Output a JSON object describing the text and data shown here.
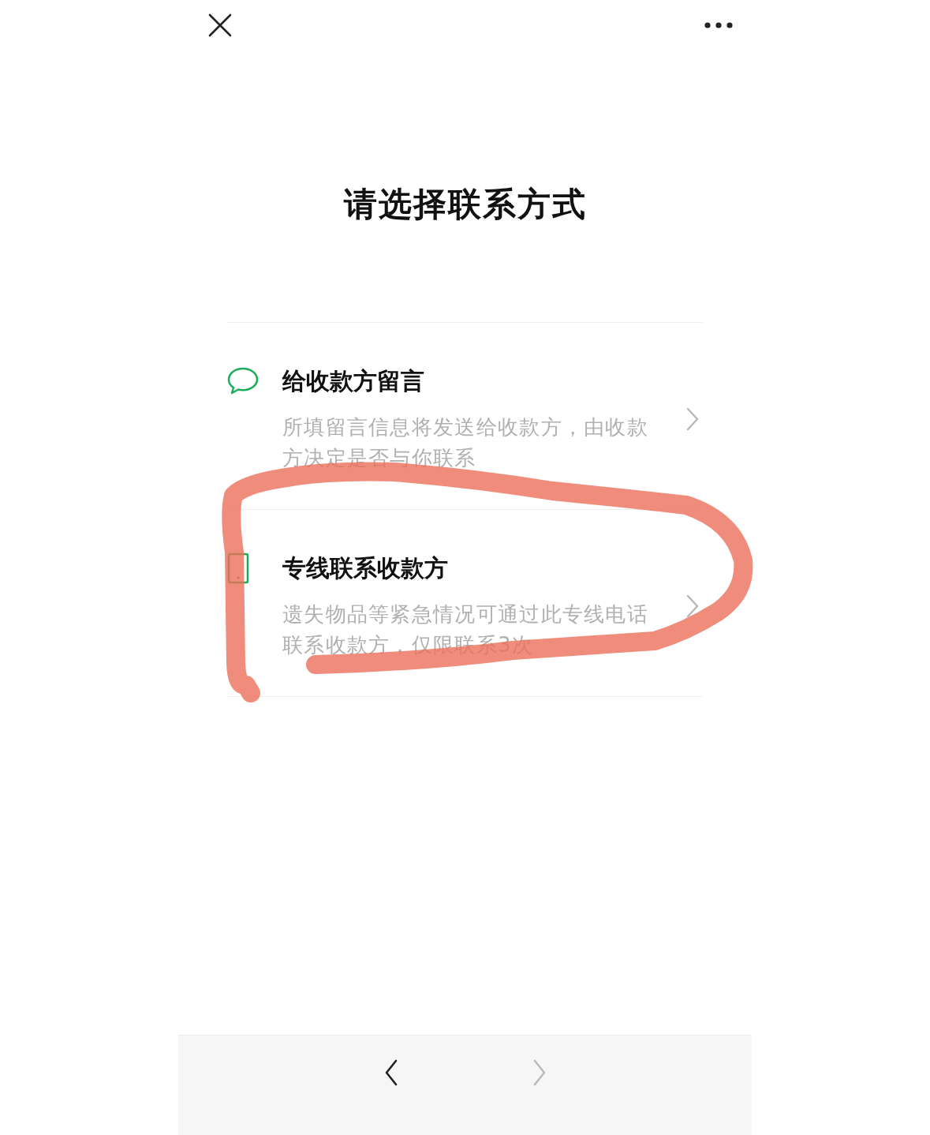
{
  "title": "请选择联系方式",
  "options": [
    {
      "kind": "chat",
      "title": "给收款方留言",
      "description": "所填留言信息将发送给收款方，由收款方决定是否与你联系"
    },
    {
      "kind": "phone",
      "title": "专线联系收款方",
      "description": "遗失物品等紧急情况可通过此专线电话联系收款方，仅限联系3次"
    }
  ],
  "nav": {
    "back_disabled": false,
    "forward_disabled": true
  }
}
